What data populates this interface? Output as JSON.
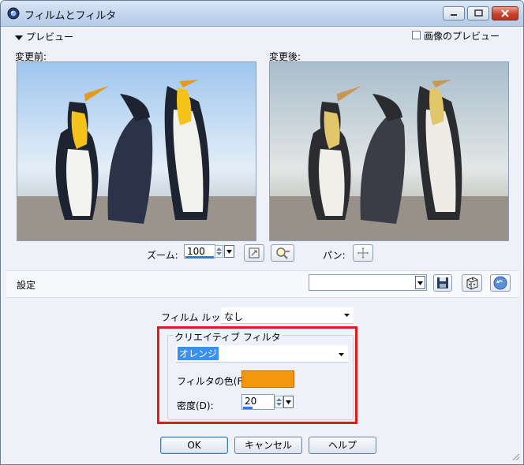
{
  "window": {
    "title": "フィルムとフィルタ"
  },
  "preview": {
    "toggle_label": "プレビュー",
    "image_preview_label": "画像のプレビュー",
    "before_label": "変更前:",
    "after_label": "変更後:"
  },
  "zoom": {
    "label": "ズーム:",
    "value": "100",
    "pan_label": "パン:"
  },
  "settings": {
    "label": "設定",
    "preset_value": ""
  },
  "film_look": {
    "label": "フィルム ルック:",
    "value": "なし"
  },
  "creative_filter": {
    "group_label": "クリエイティブ フィルタ",
    "value": "オレンジ",
    "color_label": "フィルタの色(F):",
    "color": "#f5960f",
    "density_label": "密度(D):",
    "density_value": "20"
  },
  "buttons": {
    "ok": "OK",
    "cancel": "キャンセル",
    "help": "ヘルプ"
  },
  "colors": {
    "highlight": "#e01b1b",
    "accent": "#2e7ce0"
  }
}
